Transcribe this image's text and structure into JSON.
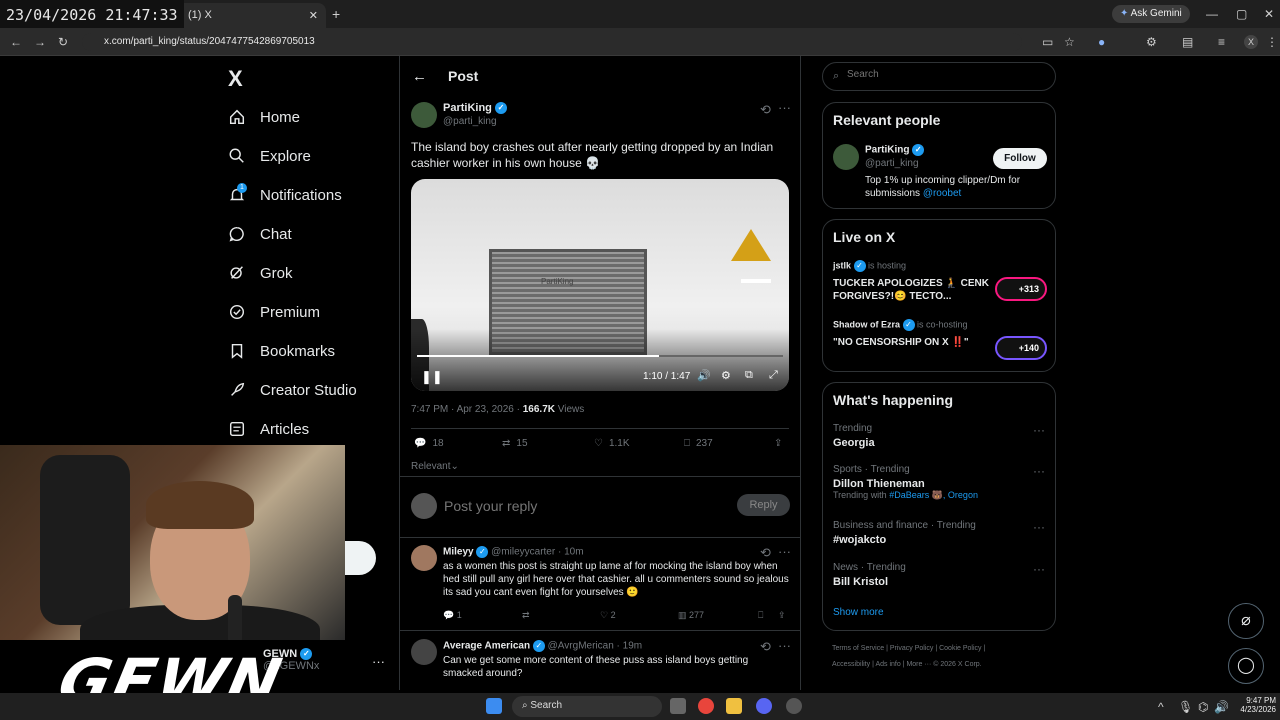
{
  "overlay": {
    "timestamp": "23/04/2026 21:47:33"
  },
  "browser": {
    "tab_label": "(1) X",
    "url": "x.com/parti_king/status/2047477542869705013",
    "ask_gemini": "Ask Gemini",
    "new_tab": "+",
    "tab_close": "✕"
  },
  "nav": {
    "logo": "X",
    "items": [
      {
        "label": "Home",
        "icon": "home-icon"
      },
      {
        "label": "Explore",
        "icon": "search-icon"
      },
      {
        "label": "Notifications",
        "icon": "bell-icon",
        "badge": "1"
      },
      {
        "label": "Chat",
        "icon": "chat-icon"
      },
      {
        "label": "Grok",
        "icon": "grok-icon"
      },
      {
        "label": "Premium",
        "icon": "x-premium-icon"
      },
      {
        "label": "Bookmarks",
        "icon": "bookmark-icon"
      },
      {
        "label": "Creator Studio",
        "icon": "rocket-icon"
      },
      {
        "label": "Articles",
        "icon": "article-icon"
      }
    ],
    "account": {
      "name": "GEWN",
      "handle": "@xGEWNx",
      "more": "···"
    }
  },
  "webcam": {
    "overlay_text": "GEWN"
  },
  "post": {
    "header": "Post",
    "author": "PartiKing",
    "handle": "@parti_king",
    "text": "The island boy crashes out after nearly getting dropped by an Indian cashier worker in his own house 💀",
    "video": {
      "time": "1:10 / 1:47",
      "progress": 0.66,
      "watermark": "PartiKing"
    },
    "date": "7:47 PM · Apr 23, 2026 · ",
    "views_count": "166.7K",
    "views_label": " Views",
    "stats": {
      "replies": "18",
      "reposts": "15",
      "likes": "1.1K",
      "bookmarks": "237"
    },
    "sort": "Relevant",
    "reply_placeholder": "Post your reply",
    "reply_button": "Reply"
  },
  "replies": [
    {
      "name": "Mileyy",
      "handle": "@mileyycarter · 10m",
      "text": "as a women this post is straight up lame af for mocking the island boy when hed still pull any girl here over that cashier. all u commenters sound so jealous its sad you cant even fight for yourselves 🙂",
      "stats": {
        "replies": "1",
        "reposts": "",
        "likes": "2",
        "views": "277"
      }
    },
    {
      "name": "Average American",
      "handle": "@AvrgMerican · 19m",
      "text": "Can we get some more content of these puss ass island boys getting smacked around?"
    }
  ],
  "search": {
    "placeholder": "Search"
  },
  "relevant": {
    "title": "Relevant people",
    "name": "PartiKing",
    "handle": "@parti_king",
    "follow": "Follow",
    "bio": "Top 1% up incoming clipper/Dm for submissions ",
    "bio_link": "@roobet"
  },
  "live": {
    "title": "Live on X",
    "items": [
      {
        "host": "jstlk",
        "status": " is hosting",
        "title": "TUCKER APOLOGIZES 🧎 CENK FORGIVES?!😊 TECTO...",
        "count": "+313"
      },
      {
        "host": "Shadow of Ezra",
        "status": " is co-hosting",
        "title": "\"NO CENSORSHIP ON X ‼️\"",
        "count": "+140"
      }
    ]
  },
  "happening": {
    "title": "What's happening",
    "items": [
      {
        "meta": "Trending",
        "topic": "Georgia"
      },
      {
        "meta": "Sports · Trending",
        "topic": "Dillon Thieneman",
        "extra": "Trending with ",
        "tags": "#DaBears 🐻, Oregon"
      },
      {
        "meta": "Business and finance · Trending",
        "topic": "#wojakcto"
      },
      {
        "meta": "News · Trending",
        "topic": "Bill Kristol"
      }
    ],
    "show_more": "Show more"
  },
  "footer": {
    "line1": "Terms of Service  |  Privacy Policy  |  Cookie Policy  |",
    "line2": "Accessibility  |  Ads info  |  More ···  © 2026 X Corp."
  },
  "taskbar": {
    "search": "Search",
    "time": "9:47 PM",
    "date": "4/23/2026"
  },
  "colors": {
    "accent": "#1d9bf0",
    "bg": "#000000",
    "border": "#2f3336"
  }
}
